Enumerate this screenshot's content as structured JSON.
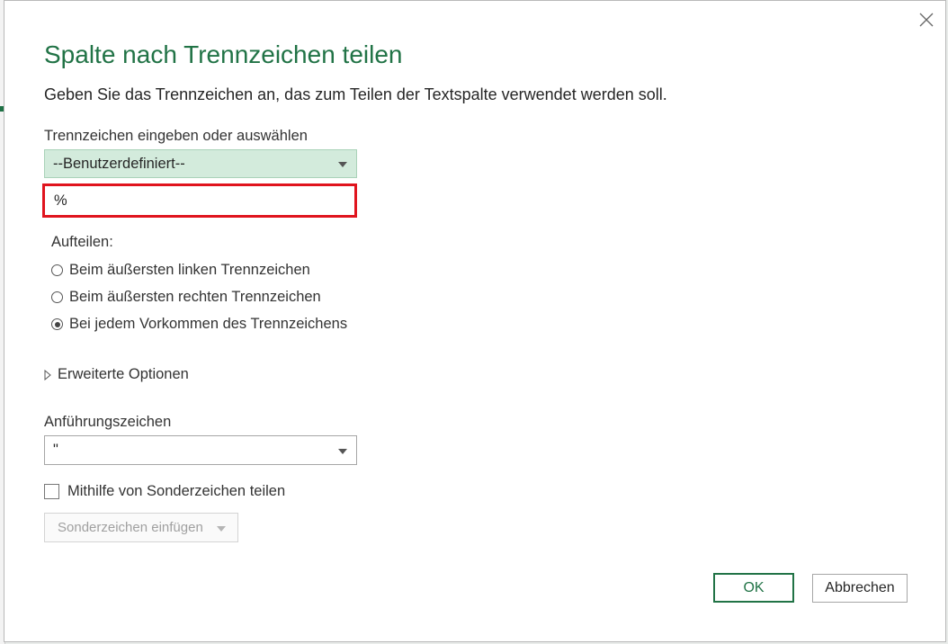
{
  "dialog": {
    "title": "Spalte nach Trennzeichen teilen",
    "subtitle": "Geben Sie das Trennzeichen an, das zum Teilen der Textspalte verwendet werden soll."
  },
  "delimiter": {
    "label": "Trennzeichen eingeben oder auswählen",
    "selected": "--Benutzerdefiniert--",
    "custom_value": "%"
  },
  "split_at": {
    "label": "Aufteilen:",
    "options": [
      {
        "label": "Beim äußersten linken Trennzeichen",
        "checked": false
      },
      {
        "label": "Beim äußersten rechten Trennzeichen",
        "checked": false
      },
      {
        "label": "Bei jedem Vorkommen des Trennzeichens",
        "checked": true
      }
    ]
  },
  "advanced": {
    "label": "Erweiterte Optionen",
    "expanded": false
  },
  "quote": {
    "label": "Anführungszeichen",
    "selected": "\""
  },
  "special": {
    "checkbox_label": "Mithilfe von Sonderzeichen teilen",
    "checked": false,
    "insert_button": "Sonderzeichen einfügen"
  },
  "buttons": {
    "ok": "OK",
    "cancel": "Abbrechen"
  },
  "colors": {
    "accent": "#217346",
    "highlight_border": "#e0141e",
    "dropdown_fill": "#d3ebdc"
  },
  "icons": {
    "close": "close-icon",
    "expand": "triangle-right-icon",
    "dropdown": "chevron-down-icon"
  }
}
